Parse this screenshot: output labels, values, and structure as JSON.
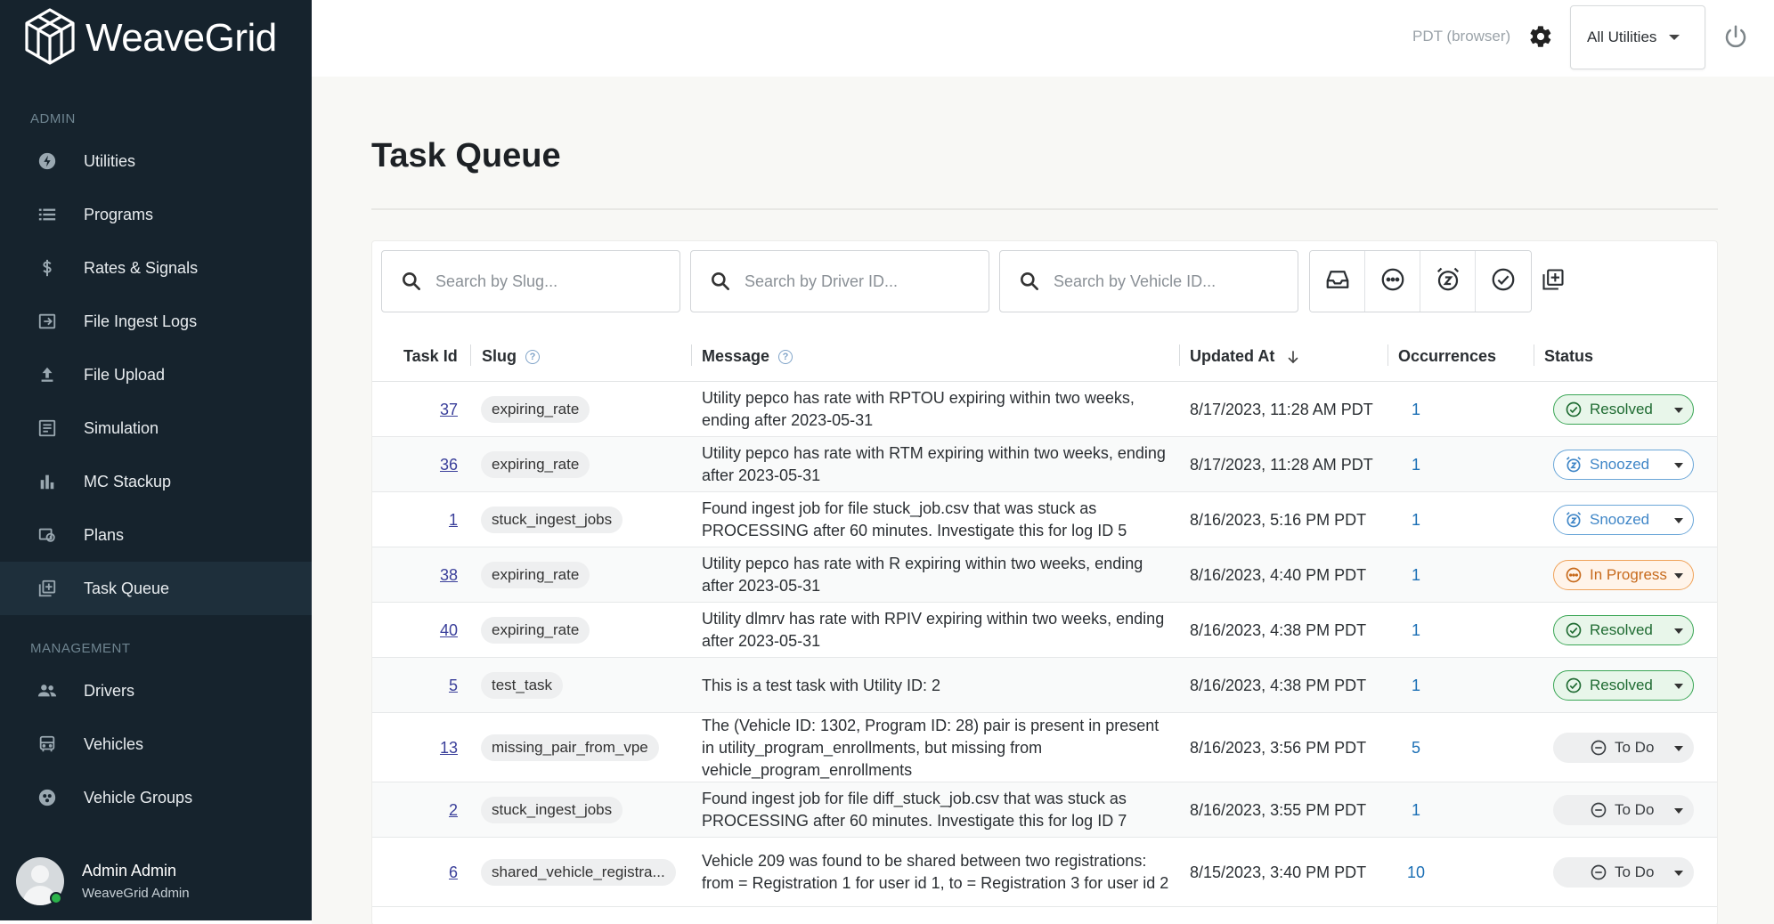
{
  "brand": {
    "name": "WeaveGrid"
  },
  "sidebar": {
    "admin_label": "ADMIN",
    "management_label": "MANAGEMENT",
    "admin_items": [
      {
        "label": "Utilities",
        "icon": "utility-icon"
      },
      {
        "label": "Programs",
        "icon": "list-icon"
      },
      {
        "label": "Rates & Signals",
        "icon": "dollar-icon"
      },
      {
        "label": "File Ingest Logs",
        "icon": "file-ingest-icon"
      },
      {
        "label": "File Upload",
        "icon": "upload-icon"
      },
      {
        "label": "Simulation",
        "icon": "simulation-icon"
      },
      {
        "label": "MC Stackup",
        "icon": "bar-chart-icon"
      },
      {
        "label": "Plans",
        "icon": "plans-icon"
      },
      {
        "label": "Task Queue",
        "icon": "task-queue-icon",
        "active": true
      }
    ],
    "management_items": [
      {
        "label": "Drivers",
        "icon": "people-icon"
      },
      {
        "label": "Vehicles",
        "icon": "vehicle-icon"
      },
      {
        "label": "Vehicle Groups",
        "icon": "vehicle-groups-icon"
      }
    ],
    "user": {
      "name": "Admin Admin",
      "role": "WeaveGrid Admin"
    }
  },
  "topbar": {
    "timezone": "PDT (browser)",
    "utility_select": "All Utilities"
  },
  "page": {
    "title": "Task Queue"
  },
  "filters": {
    "slug_placeholder": "Search by Slug...",
    "driver_placeholder": "Search by Driver ID...",
    "vehicle_placeholder": "Search by Vehicle ID...",
    "status_filters": [
      "inbox-icon",
      "in-progress-icon",
      "snoozed-icon",
      "resolved-icon"
    ]
  },
  "table": {
    "headers": {
      "task_id": "Task Id",
      "slug": "Slug",
      "message": "Message",
      "updated_at": "Updated At",
      "occurrences": "Occurrences",
      "status": "Status"
    },
    "rows": [
      {
        "id": "37",
        "slug": "expiring_rate",
        "message": "Utility pepco has rate with RPTOU expiring within two weeks, ending after 2023-05-31",
        "updated": "8/17/2023, 11:28 AM PDT",
        "occurrences": "1",
        "status": "Resolved",
        "status_kind": "resolved"
      },
      {
        "id": "36",
        "slug": "expiring_rate",
        "message": "Utility pepco has rate with RTM expiring within two weeks, ending after 2023-05-31",
        "updated": "8/17/2023, 11:28 AM PDT",
        "occurrences": "1",
        "status": "Snoozed",
        "status_kind": "snoozed"
      },
      {
        "id": "1",
        "slug": "stuck_ingest_jobs",
        "message": "Found ingest job for file stuck_job.csv that was stuck as PROCESSING after 60 minutes. Investigate this for log ID 5",
        "updated": "8/16/2023, 5:16 PM PDT",
        "occurrences": "1",
        "status": "Snoozed",
        "status_kind": "snoozed"
      },
      {
        "id": "38",
        "slug": "expiring_rate",
        "message": "Utility pepco has rate with R expiring within two weeks, ending after 2023-05-31",
        "updated": "8/16/2023, 4:40 PM PDT",
        "occurrences": "1",
        "status": "In Progress",
        "status_kind": "inprogress"
      },
      {
        "id": "40",
        "slug": "expiring_rate",
        "message": "Utility dlmrv has rate with RPIV expiring within two weeks, ending after 2023-05-31",
        "updated": "8/16/2023, 4:38 PM PDT",
        "occurrences": "1",
        "status": "Resolved",
        "status_kind": "resolved"
      },
      {
        "id": "5",
        "slug": "test_task",
        "message": "This is a test task with Utility ID: 2",
        "updated": "8/16/2023, 4:38 PM PDT",
        "occurrences": "1",
        "status": "Resolved",
        "status_kind": "resolved"
      },
      {
        "id": "13",
        "slug": "missing_pair_from_vpe",
        "message": "The (Vehicle ID: 1302, Program ID: 28) pair is present in present in utility_program_enrollments, but missing from vehicle_program_enrollments",
        "updated": "8/16/2023, 3:56 PM PDT",
        "occurrences": "5",
        "status": "To Do",
        "status_kind": "todo"
      },
      {
        "id": "2",
        "slug": "stuck_ingest_jobs",
        "message": "Found ingest job for file diff_stuck_job.csv that was stuck as PROCESSING after 60 minutes. Investigate this for log ID 7",
        "updated": "8/16/2023, 3:55 PM PDT",
        "occurrences": "1",
        "status": "To Do",
        "status_kind": "todo"
      },
      {
        "id": "6",
        "slug": "shared_vehicle_registra...",
        "message": "Vehicle 209 was found to be shared between two registrations: from = Registration 1 for user id 1, to = Registration 3 for user id 2",
        "updated": "8/15/2023, 3:40 PM PDT",
        "occurrences": "10",
        "status": "To Do",
        "status_kind": "todo"
      }
    ]
  }
}
